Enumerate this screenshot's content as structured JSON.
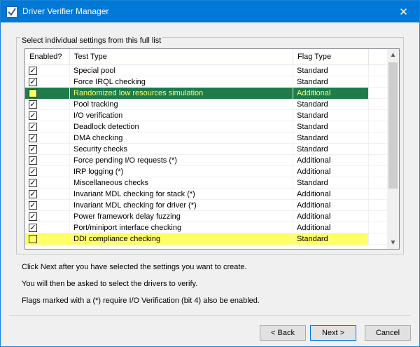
{
  "window": {
    "title": "Driver Verifier Manager",
    "close_glyph": "✕"
  },
  "group": {
    "label": "Select individual settings from this full list"
  },
  "table": {
    "columns": [
      "Enabled?",
      "Test Type",
      "Flag Type"
    ],
    "rows": [
      {
        "enabled": true,
        "test": "Special pool",
        "flag": "Standard",
        "highlight": ""
      },
      {
        "enabled": true,
        "test": "Force IRQL checking",
        "flag": "Standard",
        "highlight": ""
      },
      {
        "enabled": false,
        "test": "Randomized low resources simulation",
        "flag": "Additional",
        "highlight": "green"
      },
      {
        "enabled": true,
        "test": "Pool tracking",
        "flag": "Standard",
        "highlight": ""
      },
      {
        "enabled": true,
        "test": "I/O verification",
        "flag": "Standard",
        "highlight": ""
      },
      {
        "enabled": true,
        "test": "Deadlock detection",
        "flag": "Standard",
        "highlight": ""
      },
      {
        "enabled": true,
        "test": "DMA checking",
        "flag": "Standard",
        "highlight": ""
      },
      {
        "enabled": true,
        "test": "Security checks",
        "flag": "Standard",
        "highlight": ""
      },
      {
        "enabled": true,
        "test": "Force pending I/O requests (*)",
        "flag": "Additional",
        "highlight": ""
      },
      {
        "enabled": true,
        "test": "IRP logging (*)",
        "flag": "Additional",
        "highlight": ""
      },
      {
        "enabled": true,
        "test": "Miscellaneous checks",
        "flag": "Standard",
        "highlight": ""
      },
      {
        "enabled": true,
        "test": "Invariant MDL checking for stack (*)",
        "flag": "Additional",
        "highlight": ""
      },
      {
        "enabled": true,
        "test": "Invariant MDL checking for driver (*)",
        "flag": "Additional",
        "highlight": ""
      },
      {
        "enabled": true,
        "test": "Power framework delay fuzzing",
        "flag": "Additional",
        "highlight": ""
      },
      {
        "enabled": true,
        "test": "Port/miniport interface checking",
        "flag": "Additional",
        "highlight": ""
      },
      {
        "enabled": false,
        "test": "DDI compliance checking",
        "flag": "Standard",
        "highlight": "yellow"
      }
    ],
    "scroll_up_glyph": "▲",
    "scroll_down_glyph": "▼"
  },
  "info": {
    "line1": "Click Next after you have selected the settings you want to create.",
    "line2": "You will then be asked to select the drivers to verify.",
    "line3": "Flags marked with a (*) require I/O Verification (bit 4) also be enabled."
  },
  "buttons": {
    "back": "< Back",
    "next": "Next >",
    "cancel": "Cancel"
  },
  "colors": {
    "titlebar": "#0078d7",
    "highlight_green": "#1e7b4a",
    "highlight_yellow": "#ffff66"
  }
}
